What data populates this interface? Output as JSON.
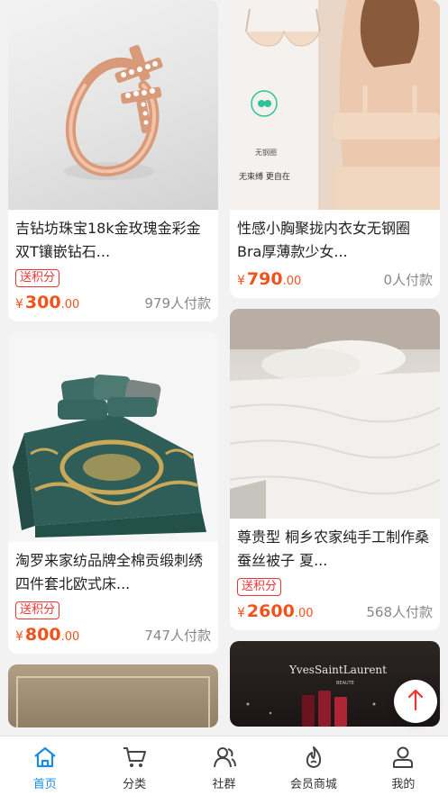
{
  "products": {
    "left": [
      {
        "title": "吉钻坊珠宝18k金玫瑰金彩金双T镶嵌钻石...",
        "tag": "送积分",
        "yen": "¥",
        "price": "300",
        "decimal": ".00",
        "paid": "979人付款"
      },
      {
        "title": "淘罗来家纺品牌全棉贡缎刺绣四件套北欧式床...",
        "tag": "送积分",
        "yen": "¥",
        "price": "800",
        "decimal": ".00",
        "paid": "747人付款"
      }
    ],
    "right": [
      {
        "title": "性感小胸聚拢内衣女无钢圈Bra厚薄款少女...",
        "yen": "¥",
        "price": "790",
        "decimal": ".00",
        "paid": "0人付款",
        "img_text_1": "无钢圈",
        "img_text_2": "无束缚 更自在"
      },
      {
        "title": "尊贵型 桐乡农家纯手工制作桑蚕丝被子 夏...",
        "tag": "送积分",
        "yen": "¥",
        "price": "2600",
        "decimal": ".00",
        "paid": "568人付款"
      }
    ],
    "ysl_logo": "YvesSaintLaurent",
    "ysl_sub": "BEAUTE"
  },
  "tabbar": {
    "items": [
      {
        "label": "首页",
        "icon": "home-icon",
        "active": true
      },
      {
        "label": "分类",
        "icon": "cart-icon",
        "active": false
      },
      {
        "label": "社群",
        "icon": "users-icon",
        "active": false
      },
      {
        "label": "会员商城",
        "icon": "flame-icon",
        "active": false
      },
      {
        "label": "我的",
        "icon": "person-icon",
        "active": false
      }
    ]
  },
  "colors": {
    "accent": "#1a8ce6",
    "price": "#f1531d",
    "tag": "#e33333"
  }
}
